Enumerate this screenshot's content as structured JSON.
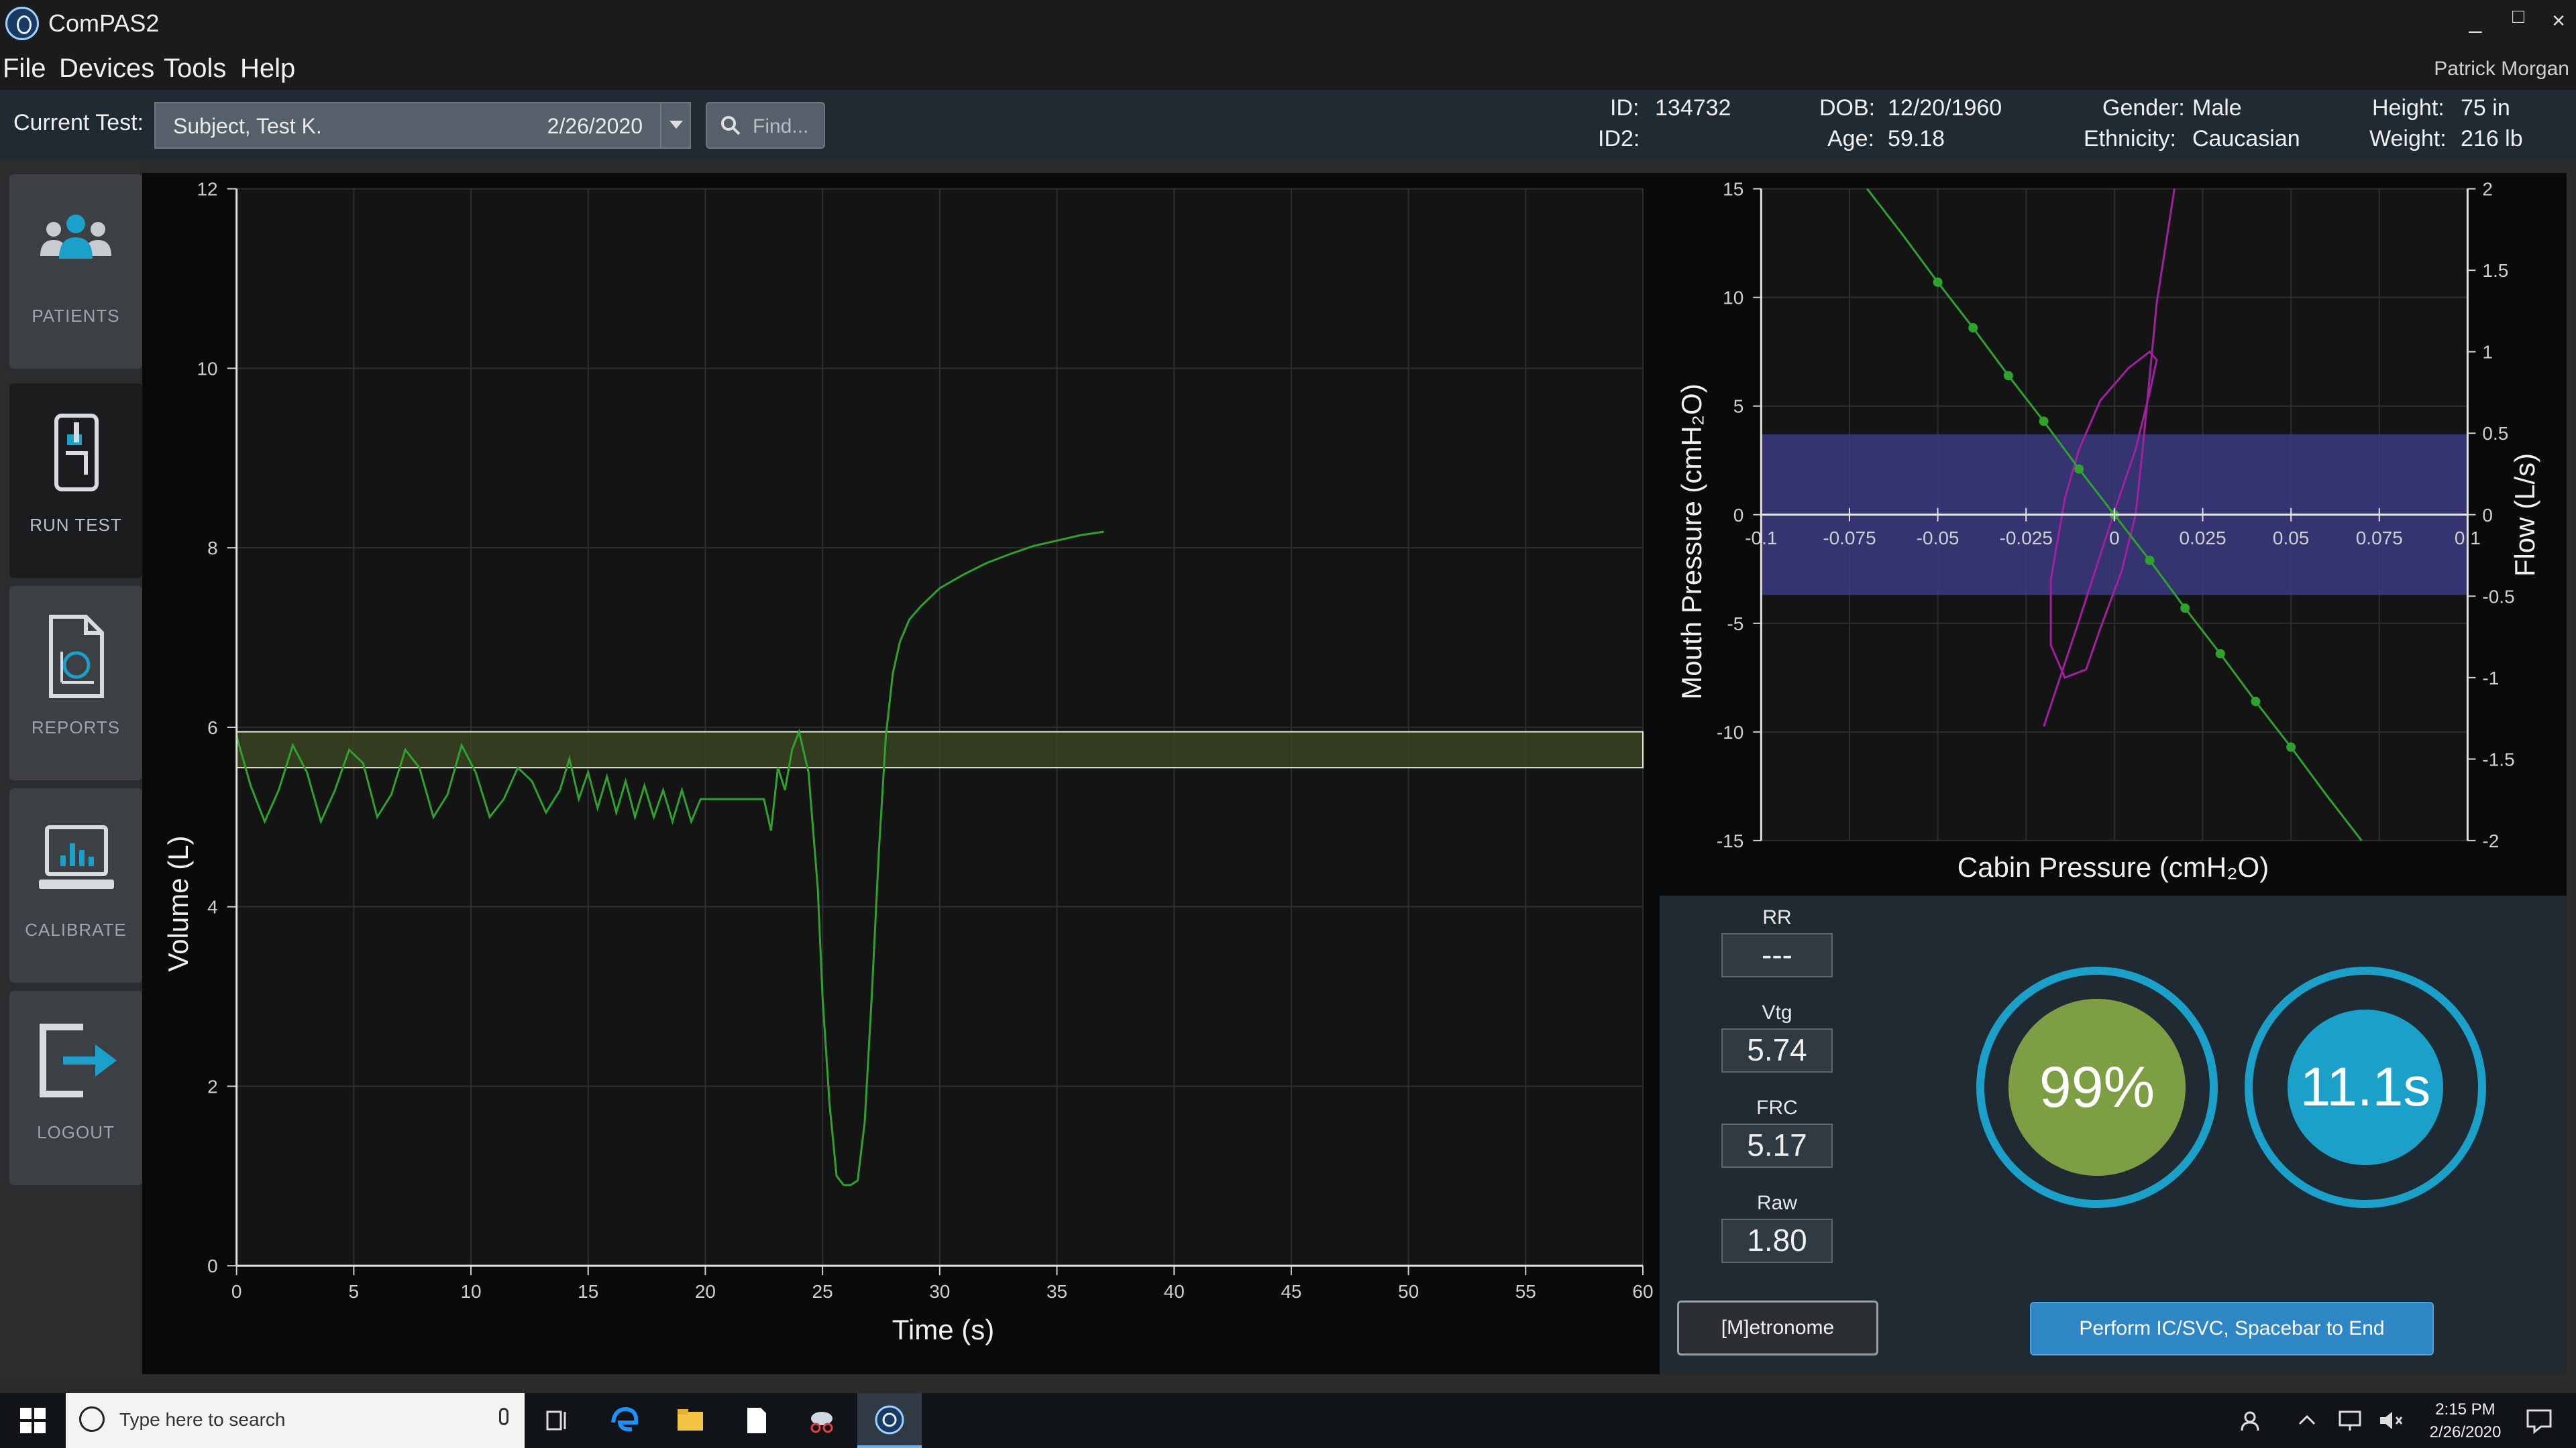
{
  "app": {
    "title": "ComPAS2",
    "user": "Patrick Morgan"
  },
  "window_controls": [
    "_",
    "□",
    "×"
  ],
  "menu": [
    "File",
    "Devices",
    "Tools",
    "Help"
  ],
  "test_bar": {
    "label": "Current Test:",
    "subject": "Subject, Test K.",
    "date": "2/26/2020",
    "find_placeholder": "Find..."
  },
  "patient": {
    "id_label": "ID:",
    "id": "134732",
    "id2_label": "ID2:",
    "id2": "",
    "dob_label": "DOB:",
    "dob": "12/20/1960",
    "age_label": "Age:",
    "age": "59.18",
    "gender_label": "Gender:",
    "gender": "Male",
    "ethnicity_label": "Ethnicity:",
    "ethnicity": "Caucasian",
    "height_label": "Height:",
    "height": "75 in",
    "weight_label": "Weight:",
    "weight": "216 lb"
  },
  "sidebar": [
    {
      "label": "PATIENTS",
      "icon": "patients-icon",
      "active": false
    },
    {
      "label": "RUN TEST",
      "icon": "run-test-icon",
      "active": true
    },
    {
      "label": "REPORTS",
      "icon": "reports-icon",
      "active": false
    },
    {
      "label": "CALIBRATE",
      "icon": "calibrate-icon",
      "active": false
    },
    {
      "label": "LOGOUT",
      "icon": "logout-icon",
      "active": false
    }
  ],
  "metrics": {
    "rr_label": "RR",
    "rr": "---",
    "vtg_label": "Vtg",
    "vtg": "5.74",
    "frc_label": "FRC",
    "frc": "5.17",
    "raw_label": "Raw",
    "raw": "1.80"
  },
  "gauges": {
    "quality": "99%",
    "time": "11.1s"
  },
  "buttons": {
    "metronome": "[M]etronome",
    "perform": "Perform IC/SVC, Spacebar to End"
  },
  "taskbar": {
    "search_placeholder": "Type here to search",
    "time": "2:15 PM",
    "date": "2/26/2020"
  },
  "colors": {
    "trace": "#2fa12f",
    "loop": "#a020a0",
    "band_green": "#3d4a22",
    "band_blue": "#3a3a80",
    "accent": "#1ba0c9",
    "quality_fill": "#7e9e44"
  },
  "chart_data": [
    {
      "type": "line",
      "xlabel": "Time (s)",
      "ylabel": "Volume (L)",
      "xlim": [
        0,
        60
      ],
      "ylim": [
        0,
        12
      ],
      "xticks": [
        0,
        5,
        10,
        15,
        20,
        25,
        30,
        35,
        40,
        45,
        50,
        55,
        60
      ],
      "yticks": [
        0,
        2,
        4,
        6,
        8,
        10,
        12
      ],
      "grid": true,
      "band": [
        5.55,
        5.95
      ],
      "series": [
        {
          "x": [
            0,
            0.6,
            1.2,
            1.8,
            2.4,
            3.0,
            3.6,
            4.2,
            4.8,
            5.4,
            6.0,
            6.6,
            7.2,
            7.8,
            8.4,
            9.0,
            9.6,
            10.2,
            10.8,
            11.4,
            12.0,
            12.6,
            13.2,
            13.8,
            14.2,
            14.6,
            15.0,
            15.4,
            15.8,
            16.2,
            16.6,
            17.0,
            17.4,
            17.8,
            18.2,
            18.6,
            19.0,
            19.4,
            19.8,
            20.5,
            21.5,
            22.5,
            22.8,
            23.1,
            23.4,
            23.7,
            24.0,
            24.4,
            24.8,
            25.0,
            25.3,
            25.6,
            25.9,
            26.2,
            26.5,
            26.8,
            27.1,
            27.4,
            27.7,
            28.0,
            28.3,
            28.7,
            29.2,
            30.0,
            31.0,
            32.0,
            33.0,
            34.0,
            35.0,
            36.0,
            37.0
          ],
          "y": [
            5.9,
            5.35,
            4.95,
            5.3,
            5.8,
            5.5,
            4.95,
            5.3,
            5.75,
            5.6,
            5.0,
            5.25,
            5.75,
            5.55,
            5.0,
            5.25,
            5.8,
            5.5,
            5.0,
            5.2,
            5.55,
            5.4,
            5.05,
            5.3,
            5.65,
            5.2,
            5.5,
            5.1,
            5.45,
            5.05,
            5.4,
            5.0,
            5.35,
            5.0,
            5.3,
            4.95,
            5.3,
            4.95,
            5.2,
            5.2,
            5.2,
            5.2,
            4.85,
            5.55,
            5.3,
            5.75,
            5.95,
            5.5,
            4.2,
            3.0,
            1.8,
            1.0,
            0.9,
            0.9,
            0.95,
            1.6,
            3.0,
            4.6,
            5.9,
            6.6,
            6.95,
            7.2,
            7.35,
            7.55,
            7.7,
            7.83,
            7.93,
            8.02,
            8.08,
            8.14,
            8.18
          ]
        }
      ]
    },
    {
      "type": "scatter",
      "xlabel": "Cabin Pressure (cmH₂O)",
      "ylabel": "Mouth Pressure (cmH₂O)",
      "y2label": "Flow (L/s)",
      "xlim": [
        -0.1,
        0.1
      ],
      "ylim": [
        -15,
        15
      ],
      "y2lim": [
        -2,
        2
      ],
      "xticks": [
        -0.1,
        -0.075,
        -0.05,
        -0.025,
        0,
        0.025,
        0.05,
        0.075,
        0.1
      ],
      "yticks": [
        -15,
        -10,
        -5,
        0,
        5,
        10,
        15
      ],
      "y2ticks": [
        -2,
        -1.5,
        -1,
        -0.5,
        0,
        0.5,
        1,
        1.5,
        2
      ],
      "grid": true,
      "band": [
        -3.7,
        3.7
      ],
      "series": [
        {
          "name": "mouth pressure",
          "x": [
            -0.07,
            -0.06,
            -0.05,
            -0.04,
            -0.03,
            -0.02,
            -0.01,
            0,
            0.01,
            0.02,
            0.03,
            0.04,
            0.05,
            0.06,
            0.07
          ],
          "y": [
            15,
            12.9,
            10.7,
            8.6,
            6.4,
            4.3,
            2.1,
            0,
            -2.1,
            -4.3,
            -6.4,
            -8.6,
            -10.7,
            -12.9,
            -15
          ]
        },
        {
          "name": "flow loop",
          "x": [
            -0.02,
            -0.01,
            0,
            0.006,
            0.01,
            0.012,
            0.01,
            0.004,
            -0.004,
            -0.01,
            -0.014,
            -0.018,
            -0.018,
            -0.014,
            -0.008,
            -0.004,
            0.002,
            0.006,
            0.008,
            0.012,
            0.017
          ],
          "y": [
            -1.3,
            -0.65,
            0.02,
            0.4,
            0.75,
            0.95,
            1.0,
            0.9,
            0.7,
            0.4,
            0.1,
            -0.4,
            -0.8,
            -1.0,
            -0.95,
            -0.7,
            -0.35,
            0.0,
            0.4,
            1.3,
            2.0
          ]
        }
      ]
    }
  ]
}
